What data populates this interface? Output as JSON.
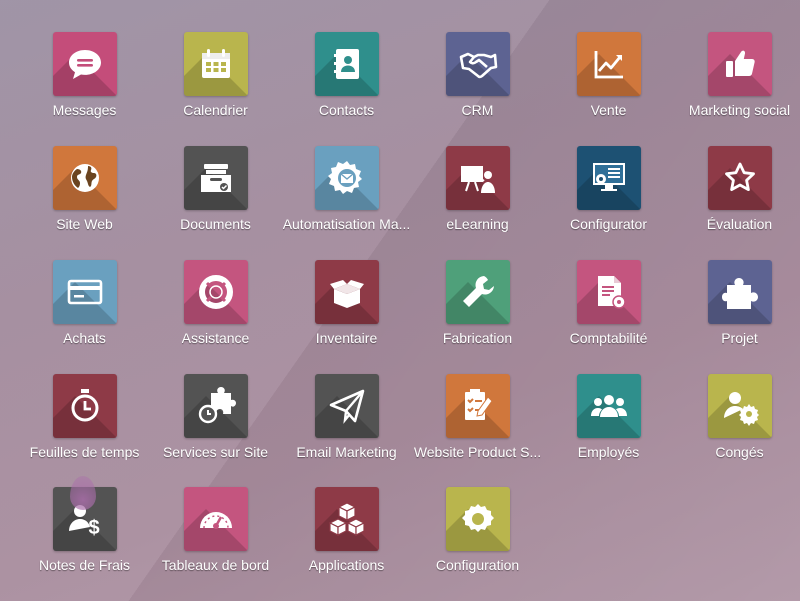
{
  "apps": [
    {
      "label": "Messages",
      "icon": "chat-bubble-icon",
      "color": "#c44d7a"
    },
    {
      "label": "Calendrier",
      "icon": "calendar-icon",
      "color": "#b9b54d"
    },
    {
      "label": "Contacts",
      "icon": "address-book-icon",
      "color": "#2f8f8c"
    },
    {
      "label": "CRM",
      "icon": "handshake-icon",
      "color": "#5d6392"
    },
    {
      "label": "Vente",
      "icon": "sales-chart-icon",
      "color": "#d0773c"
    },
    {
      "label": "Marketing social",
      "icon": "thumbs-up-icon",
      "color": "#c4557f"
    },
    {
      "label": "Site Web",
      "icon": "globe-icon",
      "color": "#d0773c"
    },
    {
      "label": "Documents",
      "icon": "document-tray-icon",
      "color": "#535353"
    },
    {
      "label": "Automatisation Ma...",
      "icon": "gear-envelope-icon",
      "color": "#6aa0bf"
    },
    {
      "label": "eLearning",
      "icon": "presentation-board-icon",
      "color": "#8e3a47"
    },
    {
      "label": "Configurator",
      "icon": "monitor-gears-icon",
      "color": "#1d5173"
    },
    {
      "label": "Évaluation",
      "icon": "star-icon",
      "color": "#8e3a47"
    },
    {
      "label": "Achats",
      "icon": "credit-card-icon",
      "color": "#6aa0bf"
    },
    {
      "label": "Assistance",
      "icon": "lifebuoy-icon",
      "color": "#c4557f"
    },
    {
      "label": "Inventaire",
      "icon": "open-box-icon",
      "color": "#8e3a47"
    },
    {
      "label": "Fabrication",
      "icon": "wrench-icon",
      "color": "#4fa07a"
    },
    {
      "label": "Comptabilité",
      "icon": "invoice-gear-icon",
      "color": "#c4557f"
    },
    {
      "label": "Projet",
      "icon": "puzzle-piece-icon",
      "color": "#5d6392"
    },
    {
      "label": "Feuilles de temps",
      "icon": "stopwatch-icon",
      "color": "#8e3a47"
    },
    {
      "label": "Services sur Site",
      "icon": "puzzle-timer-icon",
      "color": "#535353"
    },
    {
      "label": "Email Marketing",
      "icon": "paper-plane-icon",
      "color": "#535353"
    },
    {
      "label": "Website Product S...",
      "icon": "checklist-pencil-icon",
      "color": "#d0773c"
    },
    {
      "label": "Employés",
      "icon": "people-group-icon",
      "color": "#2f8f8c"
    },
    {
      "label": "Congés",
      "icon": "person-gear-icon",
      "color": "#b9b54d"
    },
    {
      "label": "Notes de Frais",
      "icon": "person-dollar-icon",
      "color": "#535353"
    },
    {
      "label": "Tableaux de bord",
      "icon": "speedometer-icon",
      "color": "#c4557f"
    },
    {
      "label": "Applications",
      "icon": "cubes-icon",
      "color": "#8e3a47"
    },
    {
      "label": "Configuration",
      "icon": "settings-gear-icon",
      "color": "#b9b54d"
    }
  ]
}
